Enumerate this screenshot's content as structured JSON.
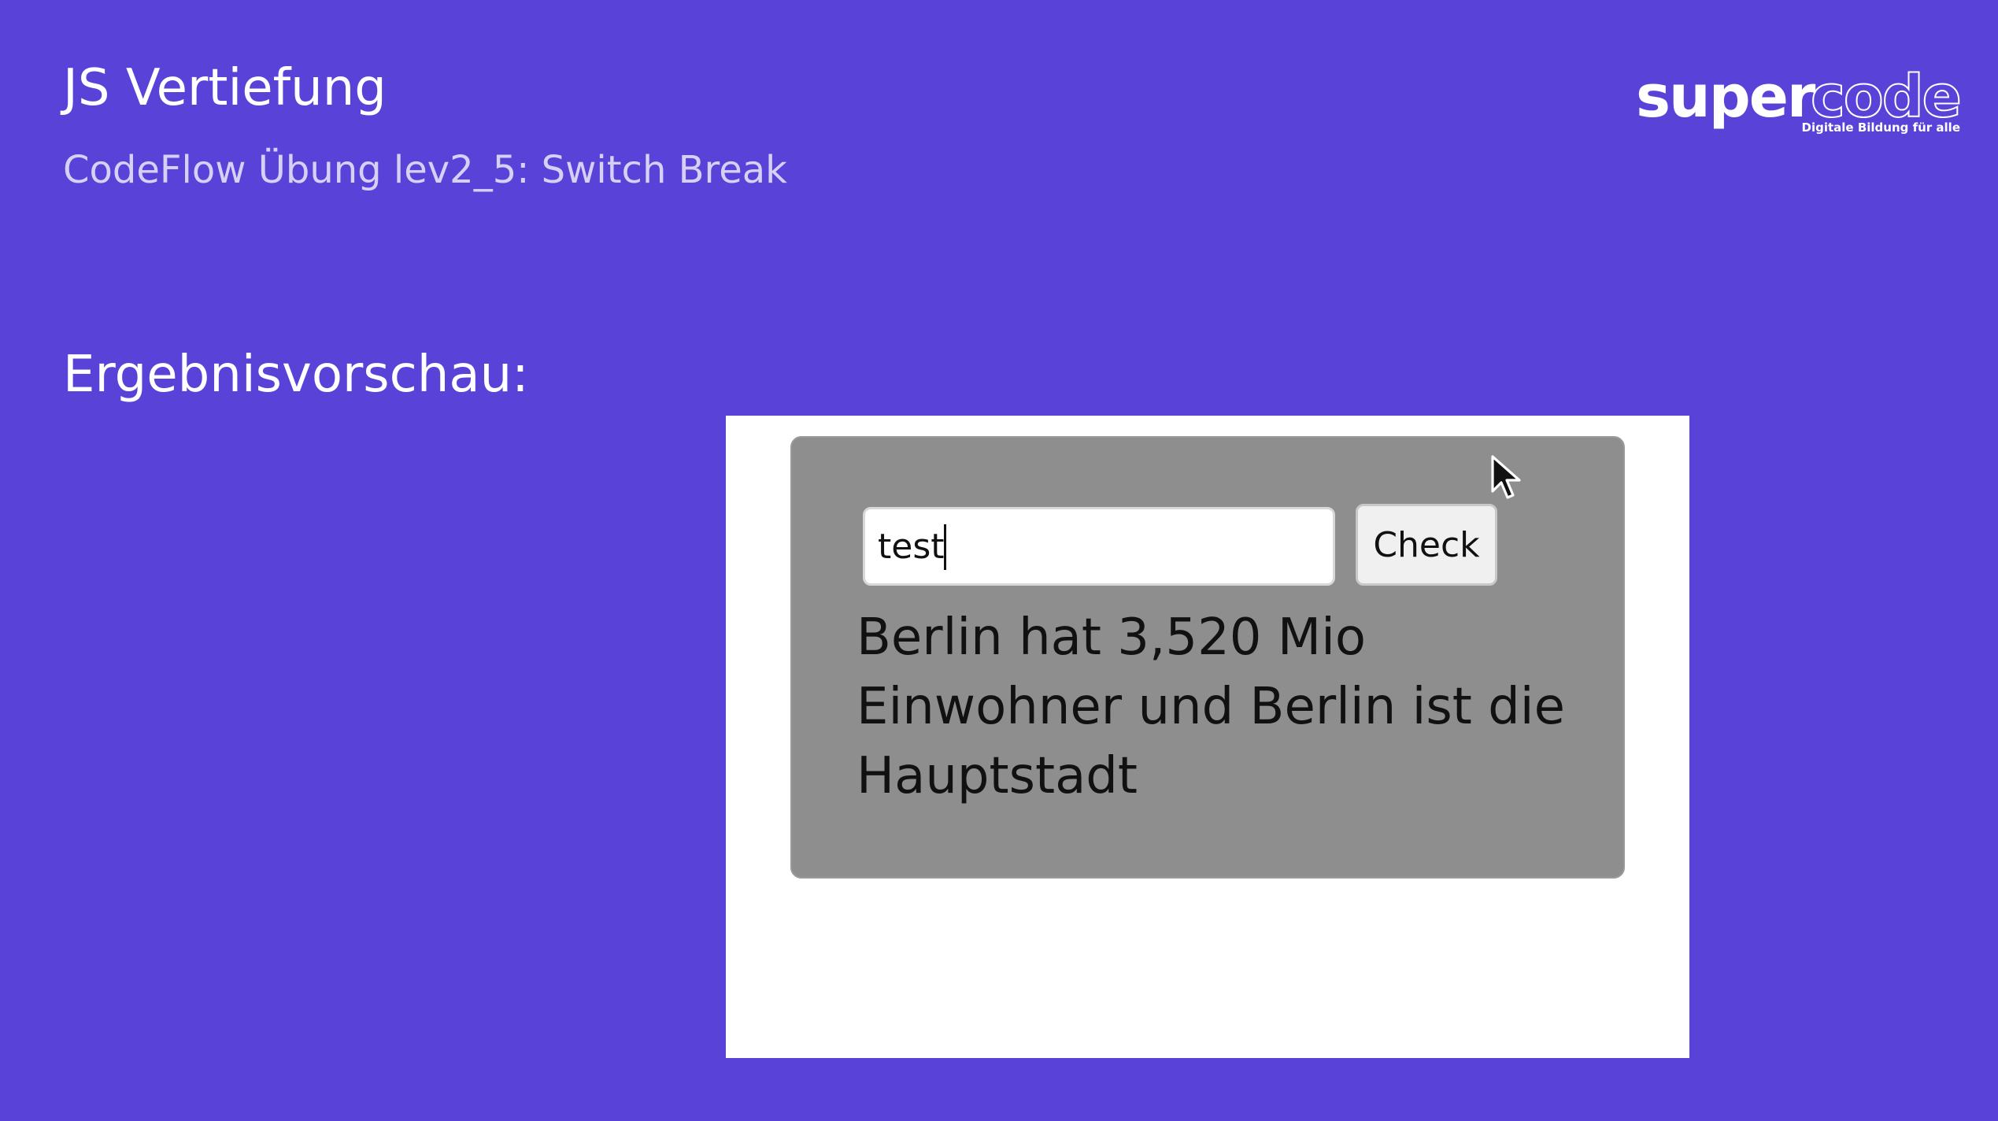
{
  "slide": {
    "title": "JS Vertiefung",
    "subtitle": "CodeFlow Übung lev2_5: Switch Break",
    "section_heading": "Ergebnisvorschau:"
  },
  "logo": {
    "part1": "super",
    "part2": "code",
    "tagline": "Digitale Bildung für alle"
  },
  "preview": {
    "input_value": "test",
    "check_button_label": "Check",
    "result_text": "Berlin hat 3,520 Mio Einwohner und Berlin ist die Hauptstadt"
  },
  "icons": {
    "cursor": "mouse-pointer-icon"
  },
  "colors": {
    "background": "#5942d8",
    "card": "#8e8e8e",
    "preview_frame": "#ffffff"
  }
}
